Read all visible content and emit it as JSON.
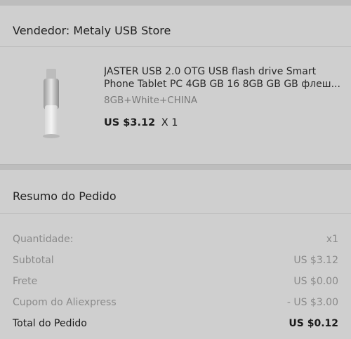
{
  "seller": {
    "label": "Vendedor: Metaly USB Store"
  },
  "product": {
    "title": "JASTER USB 2.0 OTG USB flash drive Smart Phone Tablet PC 4GB GB 16 8GB GB GB флеш...",
    "variant": "8GB+White+CHINA",
    "price": "US $3.12",
    "quantity": "X 1"
  },
  "summary": {
    "title": "Resumo do Pedido",
    "rows": [
      {
        "label": "Quantidade:",
        "value": "x1"
      },
      {
        "label": "Subtotal",
        "value": "US $3.12"
      },
      {
        "label": "Frete",
        "value": "US $0.00"
      },
      {
        "label": "Cupom do Aliexpress",
        "value": "- US $3.00"
      }
    ],
    "total": {
      "label": "Total do Pedido",
      "value": "US $0.12"
    }
  }
}
